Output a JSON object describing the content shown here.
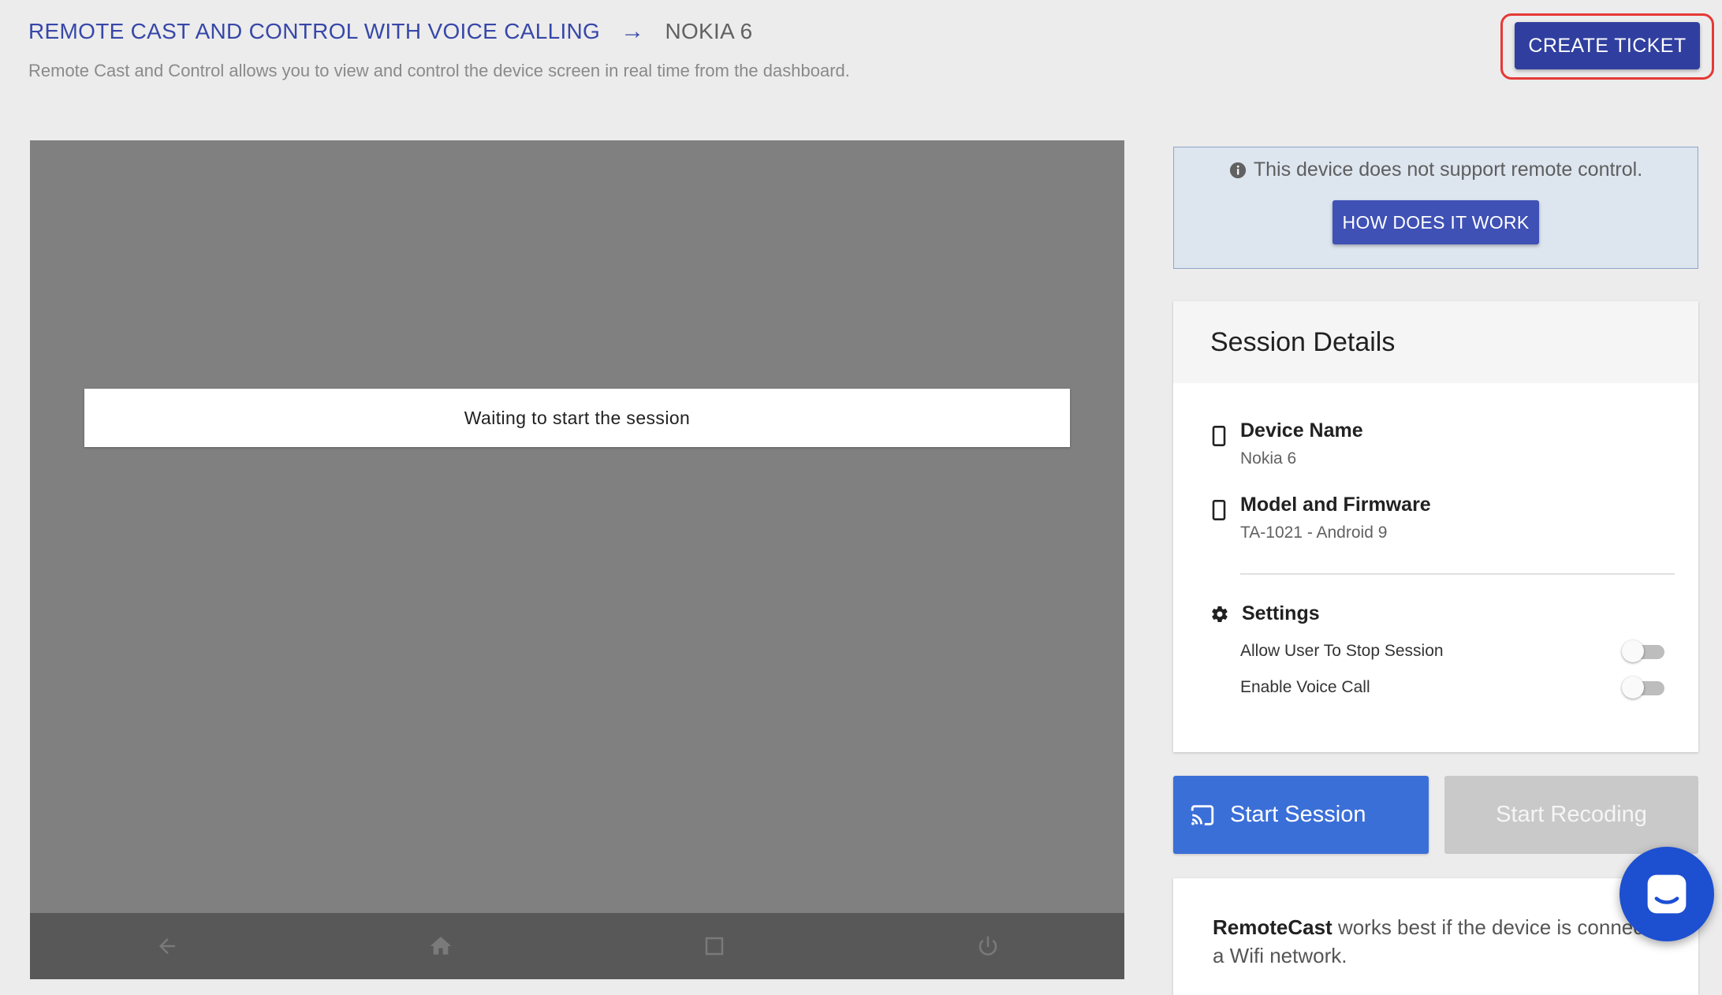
{
  "header": {
    "breadcrumb_main": "REMOTE CAST AND CONTROL WITH VOICE CALLING",
    "breadcrumb_arrow": "→",
    "breadcrumb_device": "NOKIA 6",
    "subtitle": "Remote Cast and Control allows you to view and control the device screen in real time from the dashboard.",
    "create_ticket_label": "CREATE TICKET"
  },
  "device_screen": {
    "status_message": "Waiting to start the session",
    "nav_icons": [
      "back-icon",
      "home-icon",
      "recents-icon",
      "power-icon"
    ]
  },
  "notice": {
    "icon": "info-icon",
    "text": "This device does not support remote control.",
    "button_label": "HOW DOES IT WORK"
  },
  "session_details": {
    "title": "Session Details",
    "device_name_label": "Device Name",
    "device_name_value": "Nokia 6",
    "model_label": "Model and Firmware",
    "model_value": "TA-1021 - Android 9",
    "settings_label": "Settings",
    "settings": [
      {
        "label": "Allow User To Stop Session",
        "enabled": false
      },
      {
        "label": "Enable Voice Call",
        "enabled": false
      }
    ]
  },
  "actions": {
    "start_session_label": "Start Session",
    "start_recording_label": "Start Recoding"
  },
  "tip": {
    "brand": "RemoteCast",
    "text": " works best if the device is connected to a Wifi network."
  },
  "colors": {
    "accent": "#303f9f",
    "primary_button": "#3b6fd8",
    "highlight_outline": "#e53935",
    "chat_launcher": "#1d4fd1"
  }
}
